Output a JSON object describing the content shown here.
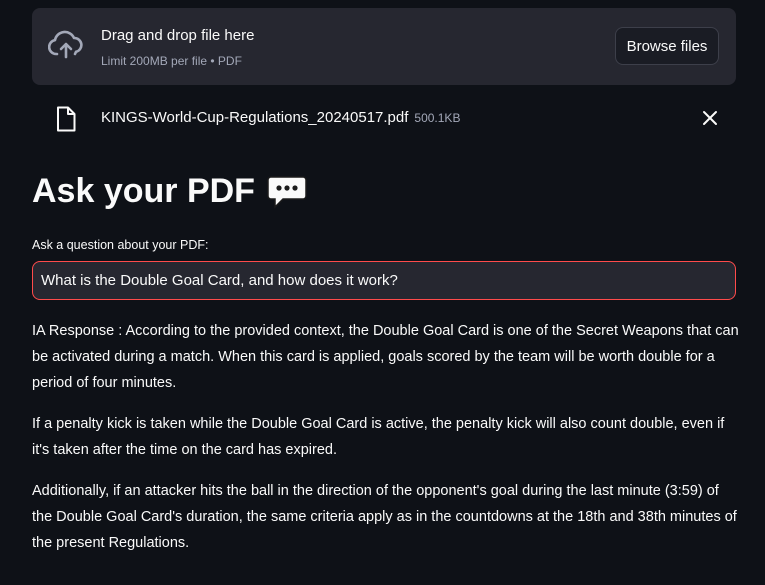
{
  "uploader": {
    "drop_title": "Drag and drop file here",
    "limit_text": "Limit 200MB per file • PDF",
    "browse_label": "Browse files"
  },
  "file": {
    "name": "KINGS-World-Cup-Regulations_20240517.pdf",
    "size": "500.1KB"
  },
  "page": {
    "title": "Ask your PDF"
  },
  "question": {
    "label": "Ask a question about your PDF:",
    "value": "What is the Double Goal Card, and how does it work?"
  },
  "response": {
    "paragraphs": [
      "IA Response : According to the provided context, the Double Goal Card is one of the Secret Weapons that can be activated during a match. When this card is applied, goals scored by the team will be worth double for a period of four minutes.",
      "If a penalty kick is taken while the Double Goal Card is active, the penalty kick will also count double, even if it's taken after the time on the card has expired.",
      "Additionally, if an attacker hits the ball in the direction of the opponent's goal during the last minute (3:59) of the Double Goal Card's duration, the same criteria apply as in the countdowns at the 18th and 38th minutes of the present Regulations."
    ]
  },
  "icons": {
    "upload": "cloud-upload-icon",
    "file": "file-icon",
    "close": "close-icon",
    "chat": "speech-bubble-icon"
  },
  "colors": {
    "background": "#0e1117",
    "panel": "#262730",
    "accent": "#ff4b4b",
    "muted_text": "#a3a8b8"
  }
}
